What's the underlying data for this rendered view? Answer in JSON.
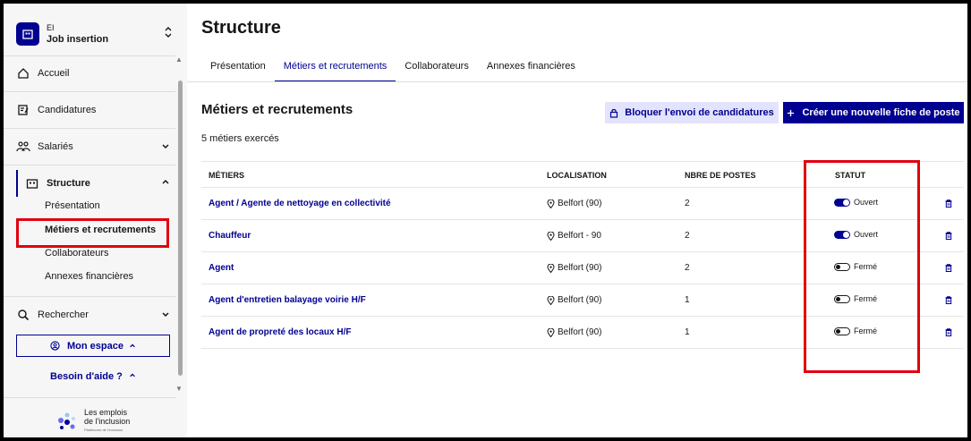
{
  "org": {
    "kind": "EI",
    "name": "Job insertion"
  },
  "nav": {
    "accueil": "Accueil",
    "candidatures": "Candidatures",
    "salaries": "Salariés",
    "structure": "Structure",
    "structure_sub": [
      "Présentation",
      "Métiers et recrutements",
      "Collaborateurs",
      "Annexes financières"
    ],
    "rechercher": "Rechercher",
    "mon_espace": "Mon espace",
    "besoin_aide": "Besoin d'aide ?"
  },
  "footer": {
    "line1": "Les emplois",
    "line2": "de l'inclusion",
    "line3": "Plateforme de l'inclusion"
  },
  "page": {
    "title": "Structure",
    "tabs": [
      "Présentation",
      "Métiers et recrutements",
      "Collaborateurs",
      "Annexes financières"
    ],
    "active_tab": "Métiers et recrutements",
    "section_title": "Métiers et recrutements",
    "count": "5 métiers exercés",
    "btn_block": "Bloquer l'envoi de candidatures",
    "btn_create": "Créer une nouvelle fiche de poste"
  },
  "table": {
    "headers": [
      "MÉTIERS",
      "LOCALISATION",
      "NBRE DE POSTES",
      "STATUT"
    ],
    "rows": [
      {
        "job": "Agent / Agente de nettoyage en collectivité",
        "location": "Belfort (90)",
        "positions": "2",
        "status": "Ouvert",
        "open": true
      },
      {
        "job": "Chauffeur",
        "location": "Belfort - 90",
        "positions": "2",
        "status": "Ouvert",
        "open": true
      },
      {
        "job": "Agent",
        "location": "Belfort (90)",
        "positions": "2",
        "status": "Fermé",
        "open": false
      },
      {
        "job": "Agent d'entretien balayage voirie H/F",
        "location": "Belfort (90)",
        "positions": "1",
        "status": "Fermé",
        "open": false
      },
      {
        "job": "Agent de propreté des locaux H/F",
        "location": "Belfort (90)",
        "positions": "1",
        "status": "Fermé",
        "open": false
      }
    ]
  },
  "colors": {
    "primary": "#000091",
    "highlight": "#e1000f",
    "light_blue": "#e3e3fd"
  }
}
